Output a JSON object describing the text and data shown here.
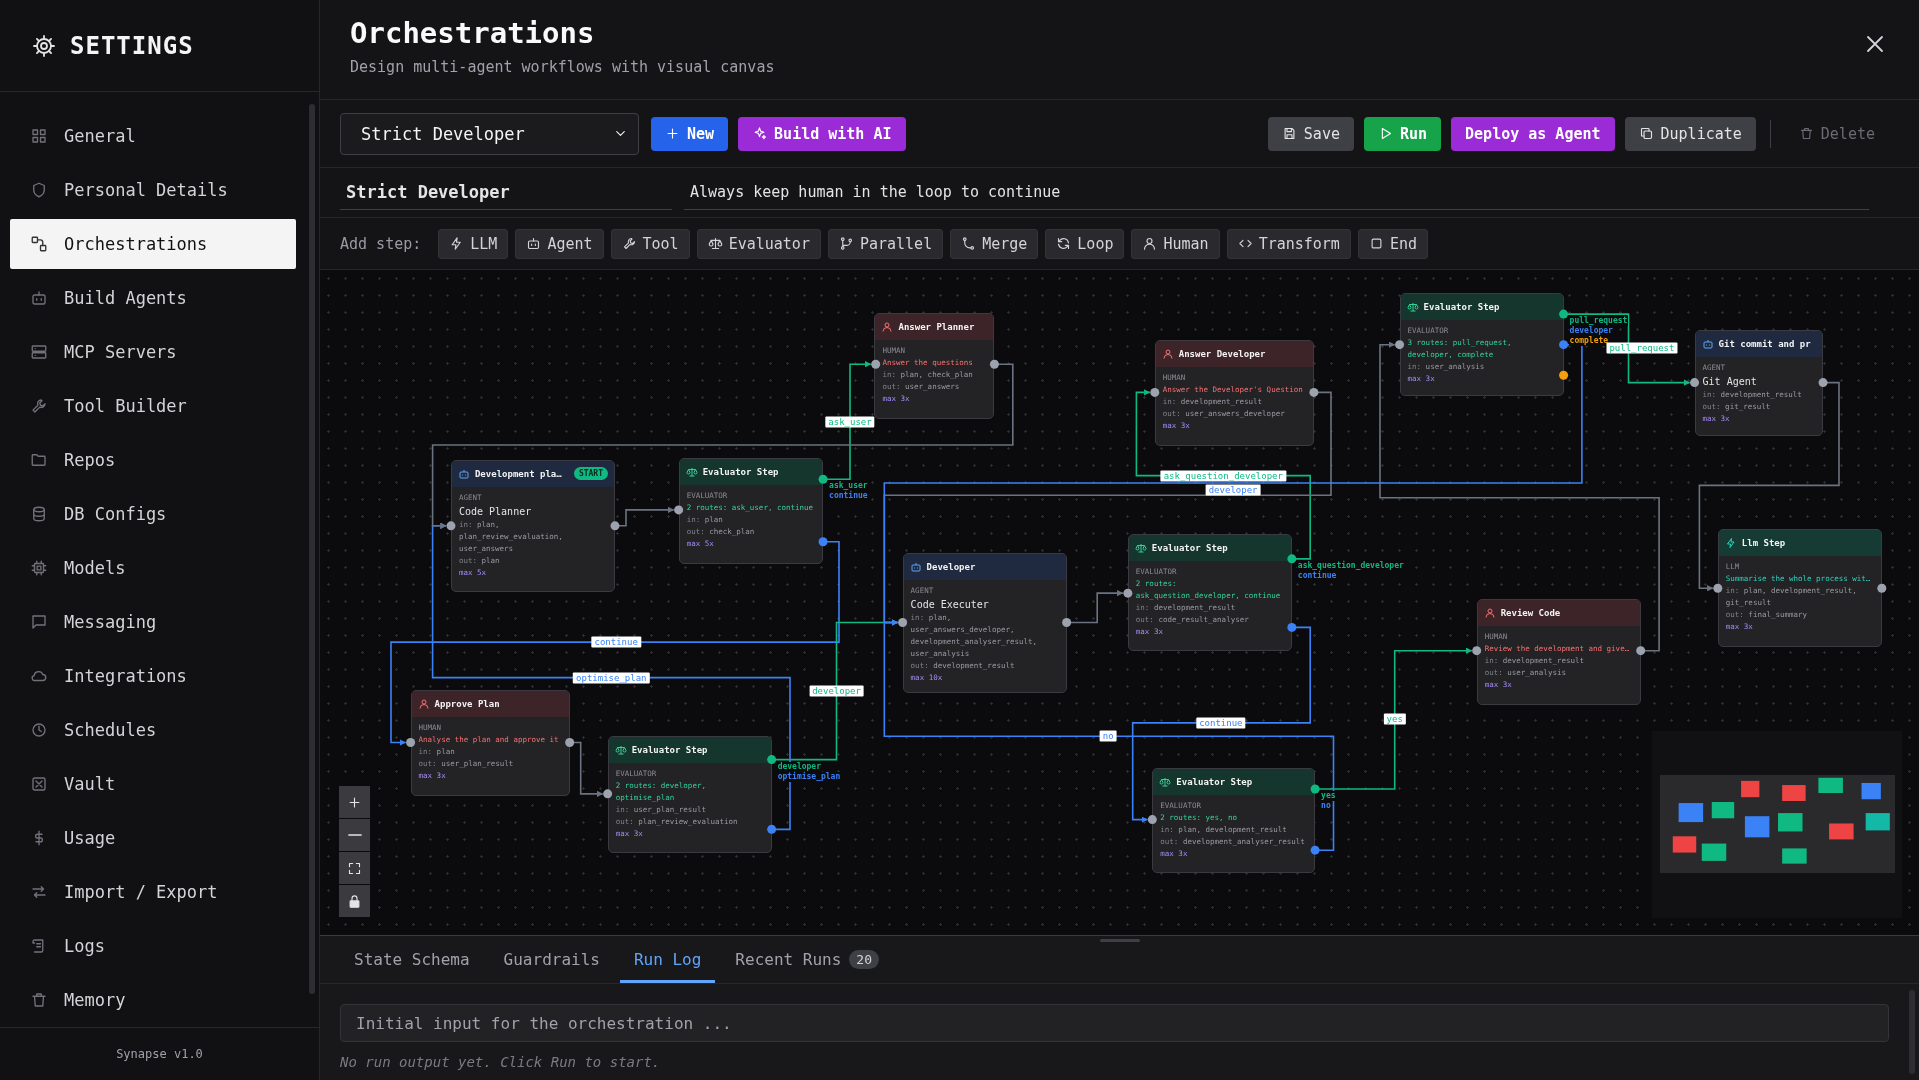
{
  "sidebar": {
    "title": "SETTINGS",
    "items": [
      {
        "label": "General",
        "selected": false
      },
      {
        "label": "Personal Details",
        "selected": false
      },
      {
        "label": "Orchestrations",
        "selected": true
      },
      {
        "label": "Build Agents",
        "selected": false
      },
      {
        "label": "MCP Servers",
        "selected": false
      },
      {
        "label": "Tool Builder",
        "selected": false
      },
      {
        "label": "Repos",
        "selected": false
      },
      {
        "label": "DB Configs",
        "selected": false
      },
      {
        "label": "Models",
        "selected": false
      },
      {
        "label": "Messaging",
        "selected": false
      },
      {
        "label": "Integrations",
        "selected": false
      },
      {
        "label": "Schedules",
        "selected": false
      },
      {
        "label": "Vault",
        "selected": false
      },
      {
        "label": "Usage",
        "selected": false
      },
      {
        "label": "Import / Export",
        "selected": false
      },
      {
        "label": "Logs",
        "selected": false
      },
      {
        "label": "Memory",
        "selected": false
      }
    ],
    "version": "Synapse v1.0"
  },
  "header": {
    "title": "Orchestrations",
    "subtitle": "Design multi-agent workflows with visual canvas"
  },
  "toolbar": {
    "preset": "Strict Developer",
    "buttons": [
      {
        "label": "New",
        "kind": "primary",
        "disabled": false
      },
      {
        "label": "Build with AI",
        "kind": "ai",
        "disabled": false
      },
      {
        "label": "Save",
        "kind": "neutral",
        "disabled": false
      },
      {
        "label": "Run",
        "kind": "run",
        "disabled": false
      },
      {
        "label": "Deploy as Agent",
        "kind": "ai",
        "disabled": false
      },
      {
        "label": "Duplicate",
        "kind": "neutral",
        "disabled": false
      },
      {
        "label": "Delete",
        "kind": "neutral",
        "disabled": true
      }
    ]
  },
  "orchestration": {
    "name": "Strict Developer",
    "description": "Always keep human in the loop to continue"
  },
  "add_step": {
    "label": "Add step:",
    "steps": [
      "LLM",
      "Agent",
      "Tool",
      "Evaluator",
      "Parallel",
      "Merge",
      "Loop",
      "Human",
      "Transform",
      "End"
    ]
  },
  "canvas": {
    "nodes": [
      {
        "kind": "agent",
        "title": "Development pla…",
        "badge": "START",
        "type_label": "AGENT",
        "detail": "Code Planner",
        "in": [
          "in:",
          "plan, plan_review_evaluation, user_answers"
        ],
        "out": [
          "out:",
          "plan"
        ],
        "max": "max 5x"
      },
      {
        "kind": "evaluator",
        "title": "Evaluator Step",
        "type_label": "EVALUATOR",
        "detail": "2 routes: ask_user, continue",
        "routes": [
          {
            "name": "ask_user",
            "color": "#10b981"
          },
          {
            "name": "continue",
            "color": "#3b82f6"
          }
        ],
        "in": [
          "in:",
          "plan"
        ],
        "out": [
          "out:",
          "check_plan"
        ],
        "max": "max 5x"
      },
      {
        "kind": "human",
        "title": "Answer Planner",
        "type_label": "HUMAN",
        "detail": "Answer the questions",
        "in": [
          "in:",
          "plan, check_plan"
        ],
        "out": [
          "out:",
          "user_answers"
        ],
        "max": "max 3x"
      },
      {
        "kind": "agent",
        "title": "Developer",
        "type_label": "AGENT",
        "detail": "Code Executer",
        "in": [
          "in:",
          "plan, user_answers_developer, development_analyser_result, user_analysis"
        ],
        "out": [
          "out:",
          "development_result"
        ],
        "max": "max 10x"
      },
      {
        "kind": "human",
        "title": "Approve Plan",
        "type_label": "HUMAN",
        "detail": "Analyse the plan and approve it",
        "in": [
          "in:",
          "plan"
        ],
        "out": [
          "out:",
          "user_plan_result"
        ],
        "max": "max 3x"
      },
      {
        "kind": "evaluator",
        "title": "Evaluator Step",
        "type_label": "EVALUATOR",
        "detail": "2 routes: developer, optimise_plan",
        "routes": [
          {
            "name": "developer",
            "color": "#10b981"
          },
          {
            "name": "optimise_plan",
            "color": "#3b82f6"
          }
        ],
        "in": [
          "in:",
          "user_plan_result"
        ],
        "out": [
          "out:",
          "plan_review_evaluation"
        ],
        "max": "max 3x"
      },
      {
        "kind": "human",
        "title": "Answer Developer",
        "type_label": "HUMAN",
        "detail": "Answer the Developer's Question",
        "in": [
          "in:",
          "development_result"
        ],
        "out": [
          "out:",
          "user_answers_developer"
        ],
        "max": "max 3x"
      },
      {
        "kind": "evaluator",
        "title": "Evaluator Step",
        "type_label": "EVALUATOR",
        "detail": "2 routes: ask_question_developer, continue",
        "routes": [
          {
            "name": "ask_question_developer",
            "color": "#10b981"
          },
          {
            "name": "continue",
            "color": "#3b82f6"
          }
        ],
        "in": [
          "in:",
          "development_result"
        ],
        "out": [
          "out:",
          "code_result_analyser"
        ],
        "max": "max 3x"
      },
      {
        "kind": "evaluator",
        "title": "Evaluator Step",
        "type_label": "EVALUATOR",
        "detail": "2 routes: yes, no",
        "routes": [
          {
            "name": "yes",
            "color": "#10b981"
          },
          {
            "name": "no",
            "color": "#3b82f6"
          }
        ],
        "in": [
          "in:",
          "plan, development_result"
        ],
        "out": [
          "out:",
          "development_analyser_result"
        ],
        "max": "max 3x"
      },
      {
        "kind": "evaluator",
        "title": "Evaluator Step",
        "type_label": "EVALUATOR",
        "detail": "3 routes: pull_request, developer, complete",
        "routes": [
          {
            "name": "pull_request",
            "color": "#10b981"
          },
          {
            "name": "developer",
            "color": "#3b82f6"
          },
          {
            "name": "complete",
            "color": "#f59e0b"
          }
        ],
        "in": [
          "in:",
          "user_analysis"
        ],
        "max": "max 3x"
      },
      {
        "kind": "agent",
        "title": "Git commit and pr",
        "type_label": "AGENT",
        "detail": "Git Agent",
        "in": [
          "in:",
          "development_result"
        ],
        "out": [
          "out:",
          "git_result"
        ],
        "max": "max 3x"
      },
      {
        "kind": "human",
        "title": "Review Code",
        "type_label": "HUMAN",
        "detail": "Review the development and give…",
        "in": [
          "in:",
          "development_result"
        ],
        "out": [
          "out:",
          "user_analysis"
        ],
        "max": "max 3x"
      },
      {
        "kind": "llm",
        "title": "Llm Step",
        "type_label": "LLM",
        "detail": "Summarise the whole process wit…",
        "in": [
          "in:",
          "plan, development_result, git_result"
        ],
        "out": [
          "out:",
          "final_summary"
        ],
        "max": "max 3x"
      }
    ],
    "edges": [
      {
        "color": "#6b7280"
      },
      {
        "color": "#10b981",
        "label": "ask_user"
      },
      {
        "color": "#3b82f6",
        "label": "continue"
      },
      {
        "color": "#6b7280"
      },
      {
        "color": "#10b981",
        "label": "developer"
      },
      {
        "color": "#3b82f6",
        "label": "optimise_plan"
      },
      {
        "color": "#6b7280"
      },
      {
        "color": "#6b7280"
      },
      {
        "color": "#10b981",
        "label": "ask_question_developer"
      },
      {
        "color": "#3b82f6",
        "label": "continue"
      },
      {
        "color": "#6b7280"
      },
      {
        "color": "#10b981",
        "label": "yes"
      },
      {
        "color": "#3b82f6",
        "label": "no"
      },
      {
        "color": "#6b7280"
      },
      {
        "color": "#10b981",
        "label": "pull_request"
      },
      {
        "color": "#3b82f6",
        "label": "developer"
      },
      {
        "color": "#6b7280"
      }
    ]
  },
  "bottom_panel": {
    "tabs": [
      {
        "label": "State Schema",
        "selected": false
      },
      {
        "label": "Guardrails",
        "selected": false
      },
      {
        "label": "Run Log",
        "selected": true
      },
      {
        "label": "Recent Runs",
        "selected": false,
        "count": "20"
      }
    ],
    "input": {
      "placeholder": "Initial input for the orchestration ..."
    },
    "hint": "No run output yet. Click Run to start."
  }
}
